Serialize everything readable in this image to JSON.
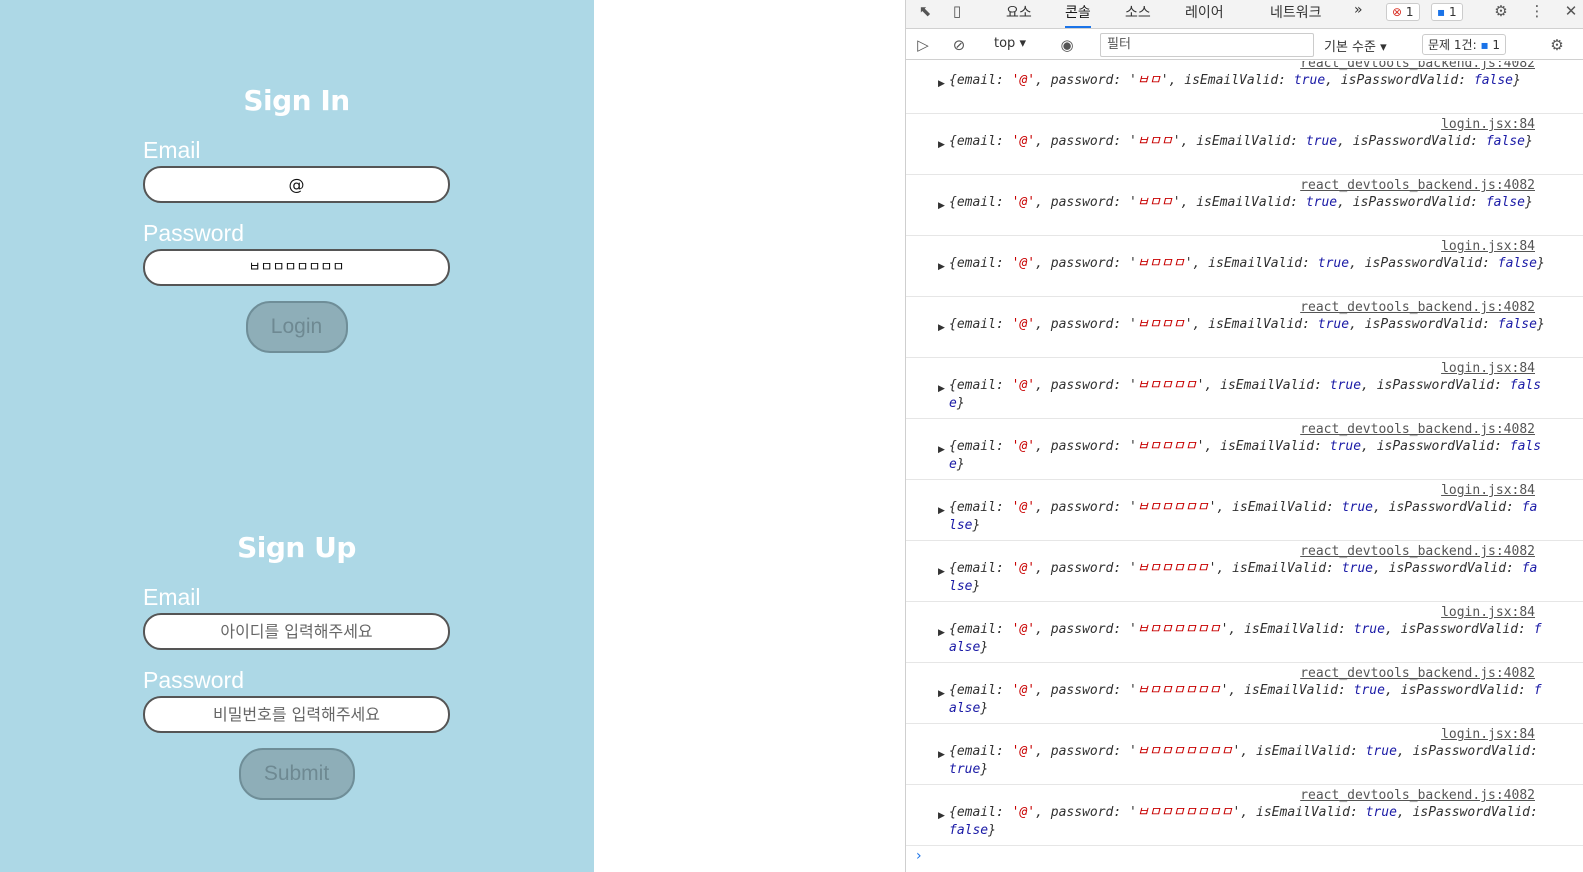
{
  "signin": {
    "title": "Sign In",
    "email_label": "Email",
    "email_value": "@",
    "password_label": "Password",
    "password_value": "ㅂㅁㅁㅁㅁㅁㅁㅁ",
    "button": "Login"
  },
  "signup": {
    "title": "Sign Up",
    "email_label": "Email",
    "email_placeholder": "아이디를 입력해주세요",
    "password_label": "Password",
    "password_placeholder": "비밀번호를 입력해주세요",
    "button": "Submit"
  },
  "devtools": {
    "tabs": [
      "요소",
      "콘솔",
      "소스",
      "레이어",
      "네트워크"
    ],
    "more": "»",
    "error_count": "1",
    "message_count": "1",
    "context": "top",
    "filter_placeholder": "필터",
    "level": "기본 수준",
    "issues_label": "문제 1건:",
    "issues_count": "1",
    "entries": [
      {
        "source": "react_devtools_backend.js:4082",
        "password": "ㅂㅁ",
        "passwordValid": "false"
      },
      {
        "source": "login.jsx:84",
        "password": "ㅂㅁㅁ",
        "passwordValid": "false"
      },
      {
        "source": "react_devtools_backend.js:4082",
        "password": "ㅂㅁㅁ",
        "passwordValid": "false"
      },
      {
        "source": "login.jsx:84",
        "password": "ㅂㅁㅁㅁ",
        "passwordValid": "false"
      },
      {
        "source": "react_devtools_backend.js:4082",
        "password": "ㅂㅁㅁㅁ",
        "passwordValid": "false"
      },
      {
        "source": "login.jsx:84",
        "password": "ㅂㅁㅁㅁㅁ",
        "passwordValid": "false"
      },
      {
        "source": "react_devtools_backend.js:4082",
        "password": "ㅂㅁㅁㅁㅁ",
        "passwordValid": "false"
      },
      {
        "source": "login.jsx:84",
        "password": "ㅂㅁㅁㅁㅁㅁ",
        "passwordValid": "false"
      },
      {
        "source": "react_devtools_backend.js:4082",
        "password": "ㅂㅁㅁㅁㅁㅁ",
        "passwordValid": "false"
      },
      {
        "source": "login.jsx:84",
        "password": "ㅂㅁㅁㅁㅁㅁㅁ",
        "passwordValid": "false"
      },
      {
        "source": "react_devtools_backend.js:4082",
        "password": "ㅂㅁㅁㅁㅁㅁㅁ",
        "passwordValid": "false"
      },
      {
        "source": "login.jsx:84",
        "password": "ㅂㅁㅁㅁㅁㅁㅁㅁ",
        "passwordValid": "true"
      },
      {
        "source": "react_devtools_backend.js:4082",
        "password": "ㅂㅁㅁㅁㅁㅁㅁㅁ",
        "passwordValid": "false"
      }
    ]
  }
}
